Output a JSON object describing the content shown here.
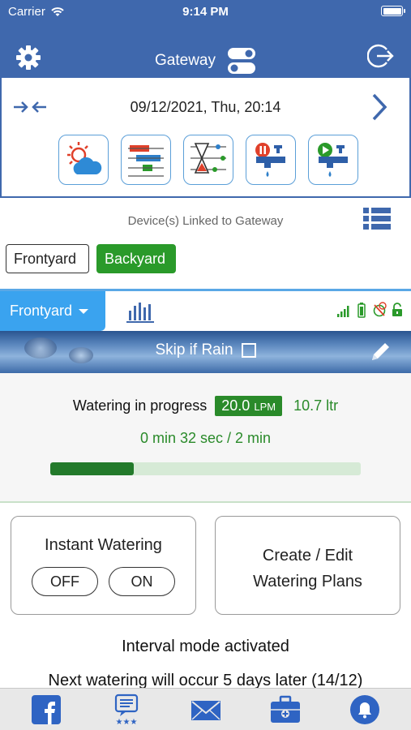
{
  "status_bar": {
    "carrier": "Carrier",
    "time": "9:14 PM"
  },
  "nav": {
    "title": "Gateway",
    "icons": [
      "gear-icon",
      "toggle-icon",
      "logout-icon"
    ]
  },
  "date_panel": {
    "datetime": "09/12/2021, Thu, 20:14",
    "tools": [
      "weather-icon",
      "schedule-icon",
      "timer-icon",
      "tap-pause-icon",
      "tap-play-icon"
    ]
  },
  "devices": {
    "label": "Device(s) Linked to Gateway",
    "items": [
      {
        "label": "Frontyard",
        "selected": false
      },
      {
        "label": "Backyard",
        "selected": true
      }
    ]
  },
  "tab": {
    "active_label": "Frontyard"
  },
  "banner": {
    "skip_label": "Skip if Rain",
    "skip_checked": false
  },
  "watering": {
    "status": "Watering in progress",
    "rate_value": "20.0",
    "rate_unit": "LPM",
    "volume": "10.7 ltr",
    "timer": "0 min 32 sec / 2 min",
    "progress": 0.27
  },
  "instant": {
    "title": "Instant Watering",
    "off_label": "OFF",
    "on_label": "ON"
  },
  "plans": {
    "line1": "Create / Edit",
    "line2": "Watering Plans"
  },
  "messages": {
    "interval": "Interval mode activated",
    "next": "Next watering will occur 5 days later (14/12)"
  },
  "colors": {
    "brand": "#3f68ad",
    "accent": "#3aa3ef",
    "green": "#2a9a2a"
  },
  "bottom_bar": [
    "facebook-icon",
    "reviews-icon",
    "mail-icon",
    "toolbox-icon",
    "notification-bell-icon"
  ]
}
